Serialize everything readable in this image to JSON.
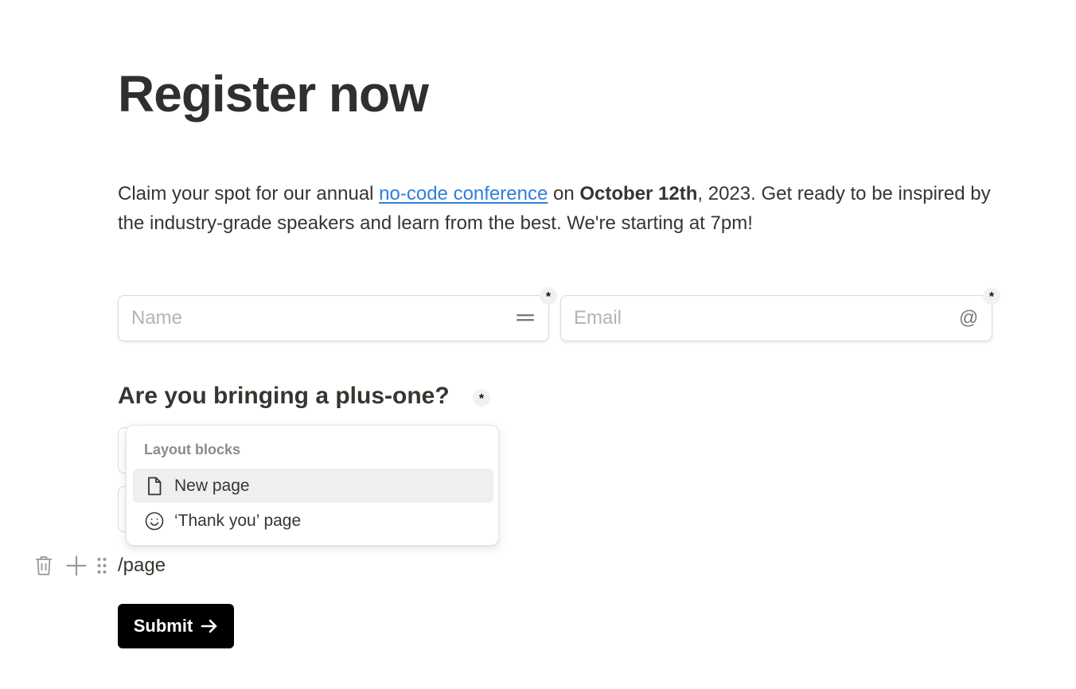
{
  "page": {
    "title": "Register now"
  },
  "intro": {
    "part1": "Claim your spot for our annual ",
    "link_text": "no-code conference",
    "part2": " on ",
    "bold_date": "October 12th",
    "part3": ", 2023. Get ready to be inspired by the industry-grade speakers and learn from the best. We're starting at 7pm!"
  },
  "fields": {
    "name": {
      "placeholder": "Name",
      "value": "",
      "required_mark": "*",
      "icon": "short-text-icon"
    },
    "email": {
      "placeholder": "Email",
      "value": "",
      "required_mark": "*",
      "icon": "at-sign-icon",
      "icon_glyph": "@"
    }
  },
  "question": {
    "label": "Are you bringing a plus-one?",
    "required_mark": "*"
  },
  "slash_menu": {
    "heading": "Layout blocks",
    "items": [
      {
        "label": "New page",
        "icon": "page-icon",
        "selected": true
      },
      {
        "label": "‘Thank you’ page",
        "icon": "smiley-icon",
        "selected": false
      }
    ]
  },
  "block": {
    "text": "/page",
    "icons": [
      "trash-icon",
      "plus-icon",
      "drag-handle-icon"
    ]
  },
  "submit": {
    "label": "Submit",
    "icon": "arrow-right-icon"
  },
  "colors": {
    "link": "#2f7fd8",
    "text": "#37352f",
    "button_bg": "#000000",
    "button_text": "#ffffff",
    "menu_selected_bg": "#efefef"
  }
}
